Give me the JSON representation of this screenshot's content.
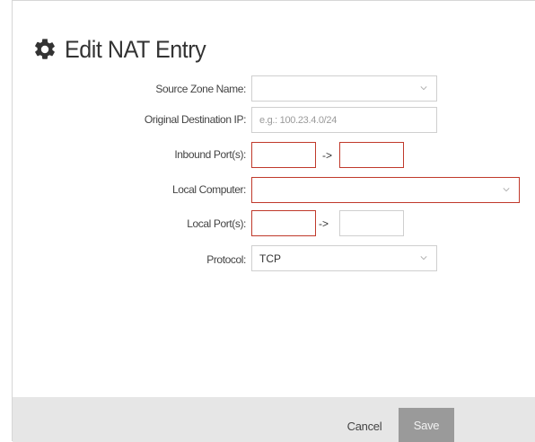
{
  "dialog": {
    "title": "Edit NAT Entry",
    "title_icon": "gear-icon"
  },
  "form": {
    "source_zone": {
      "label": "Source Zone Name:",
      "value": ""
    },
    "original_dest_ip": {
      "label": "Original Destination IP:",
      "placeholder": "e.g.: 100.23.4.0/24",
      "value": ""
    },
    "inbound_ports": {
      "label": "Inbound Port(s):",
      "separator": "->",
      "from": "",
      "to": ""
    },
    "local_computer": {
      "label": "Local Computer:",
      "value": ""
    },
    "local_ports": {
      "label": "Local Port(s):",
      "separator": "->",
      "from": "",
      "to": ""
    },
    "protocol": {
      "label": "Protocol:",
      "value": "TCP"
    }
  },
  "footer": {
    "cancel_label": "Cancel",
    "save_label": "Save"
  },
  "colors": {
    "invalid_border": "#c0392b",
    "save_button_bg": "#9a9a9a",
    "footer_bg": "#e6e6e6"
  }
}
